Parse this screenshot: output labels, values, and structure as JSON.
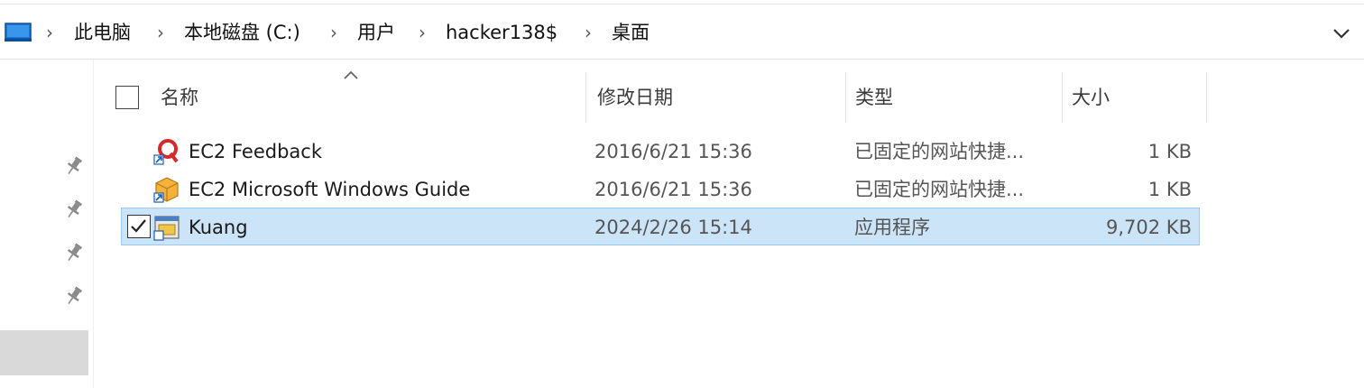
{
  "address_bar": {
    "computer_icon": "computer-icon",
    "breadcrumbs": [
      {
        "label": "此电脑"
      },
      {
        "label": "本地磁盘 (C:)"
      },
      {
        "label": "用户"
      },
      {
        "label": "hacker138$"
      },
      {
        "label": "桌面"
      }
    ],
    "separator_icon": "chevron-right-icon",
    "dropdown_icon": "chevron-down-icon"
  },
  "nav_pane": {
    "pin_icon": "pin-icon",
    "pinned_count": 4
  },
  "columns": {
    "name": "名称",
    "date_modified": "修改日期",
    "type": "类型",
    "size": "大小",
    "sort_icon": "sort-ascending-icon"
  },
  "files": [
    {
      "icon": "web-shortcut-feedback-icon",
      "name": "EC2 Feedback",
      "date_modified": "2016/6/21 15:36",
      "type": "已固定的网站快捷...",
      "size": "1 KB",
      "selected": false
    },
    {
      "icon": "web-shortcut-guide-icon",
      "name": "EC2 Microsoft Windows Guide",
      "date_modified": "2016/6/21 15:36",
      "type": "已固定的网站快捷...",
      "size": "1 KB",
      "selected": false
    },
    {
      "icon": "application-icon",
      "name": "Kuang",
      "date_modified": "2024/2/26 15:14",
      "type": "应用程序",
      "size": "9,702 KB",
      "selected": true
    }
  ],
  "colors": {
    "selection_bg": "#cce4f7",
    "selection_border": "#99c9ef",
    "computer_icon_blue": "#1e7ad8"
  }
}
